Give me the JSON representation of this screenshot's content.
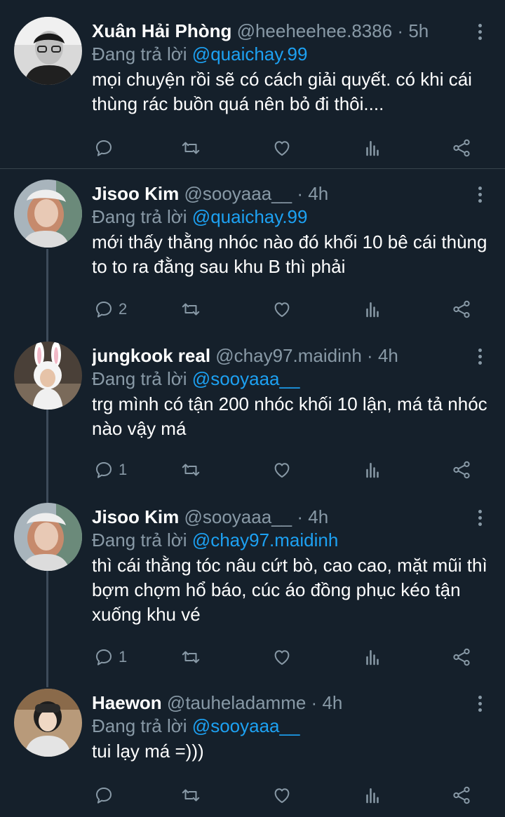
{
  "tweets": [
    {
      "name": "Xuân Hải Phòng",
      "handle": "@heeheehee.8386",
      "time": "5h",
      "replying_prefix": "Đang trả lời",
      "replying_to": "@quaichay.99",
      "text": "mọi chuyện rồi sẽ có cách giải quyết. có khi cái thùng rác buồn quá nên bỏ đi thôi....",
      "reply_count": ""
    },
    {
      "name": "Jisoo Kim",
      "handle": "@sooyaaa__",
      "time": "4h",
      "replying_prefix": "Đang trả lời",
      "replying_to": "@quaichay.99",
      "text": "mới thấy thằng nhóc nào đó khối 10 bê cái thùng to to ra đằng sau khu B thì phải",
      "reply_count": "2"
    },
    {
      "name": "jungkook real",
      "handle": "@chay97.maidinh",
      "time": "4h",
      "replying_prefix": "Đang trả lời",
      "replying_to": "@sooyaaa__",
      "text": "trg mình có tận 200 nhóc khối 10 lận, má tả nhóc nào vậy má",
      "reply_count": "1"
    },
    {
      "name": "Jisoo Kim",
      "handle": "@sooyaaa__",
      "time": "4h",
      "replying_prefix": "Đang trả lời",
      "replying_to": "@chay97.maidinh",
      "text": "thì cái thằng tóc nâu cứt bò, cao cao, mặt mũi thì bợm chợm hổ báo, cúc áo đồng phục kéo tận xuống khu vé",
      "reply_count": "1"
    },
    {
      "name": "Haewon",
      "handle": "@tauheladamme",
      "time": "4h",
      "replying_prefix": "Đang trả lời",
      "replying_to": "@sooyaaa__",
      "text": "tui lạy má =)))",
      "reply_count": ""
    }
  ],
  "separator": "·",
  "icons": [
    "reply-icon",
    "retweet-icon",
    "like-icon",
    "analytics-icon",
    "share-icon",
    "more-options-icon"
  ],
  "colors": {
    "background": "#15202b",
    "text": "#ffffff",
    "muted": "#8899a6",
    "link": "#1da1f2"
  }
}
